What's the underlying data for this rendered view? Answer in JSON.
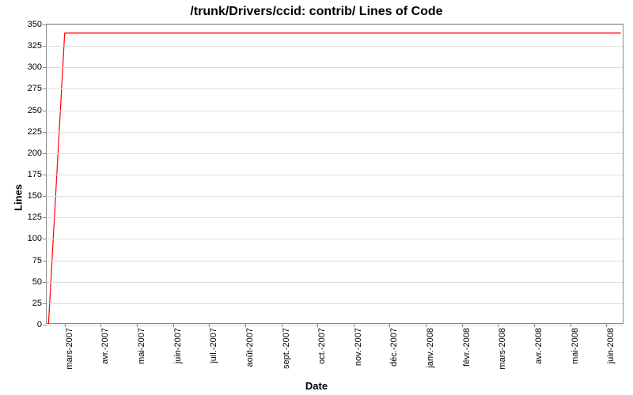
{
  "chart_data": {
    "type": "line",
    "title": "/trunk/Drivers/ccid: contrib/ Lines of Code",
    "xlabel": "Date",
    "ylabel": "Lines",
    "ylim": [
      0,
      350
    ],
    "y_ticks": [
      0,
      25,
      50,
      75,
      100,
      125,
      150,
      175,
      200,
      225,
      250,
      275,
      300,
      325,
      350
    ],
    "categories": [
      "mars-2007",
      "avr.-2007",
      "mai-2007",
      "juin-2007",
      "juil.-2007",
      "août-2007",
      "sept.-2007",
      "oct.-2007",
      "nov.-2007",
      "déc.-2007",
      "janv.-2008",
      "févr.-2008",
      "mars-2008",
      "avr.-2008",
      "mai-2008",
      "juin-2008"
    ],
    "series": [
      {
        "name": "Lines of Code",
        "color": "#ff0000",
        "values": [
          0,
          340,
          340,
          340,
          340,
          340,
          340,
          340,
          340,
          340,
          340,
          340,
          340,
          340,
          340,
          340,
          340
        ]
      }
    ],
    "grid": {
      "x": false,
      "y": true
    }
  }
}
